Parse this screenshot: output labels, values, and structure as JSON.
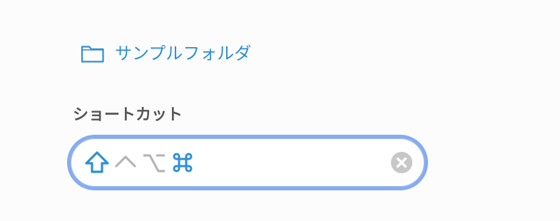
{
  "folder": {
    "label": "サンプルフォルダ",
    "icon": "folder-icon",
    "color": "#2f8fd4"
  },
  "shortcut": {
    "label": "ショートカット",
    "modifiers": [
      {
        "name": "shift",
        "icon": "shift-icon",
        "active": true
      },
      {
        "name": "control",
        "icon": "control-icon",
        "active": false
      },
      {
        "name": "option",
        "icon": "option-icon",
        "active": false
      },
      {
        "name": "command",
        "icon": "command-icon",
        "active": true
      }
    ],
    "clear_icon": "clear-icon",
    "active_color": "#2f8fd4",
    "inactive_color": "#b5b5b5",
    "focus_ring_color": "#86abf0"
  }
}
